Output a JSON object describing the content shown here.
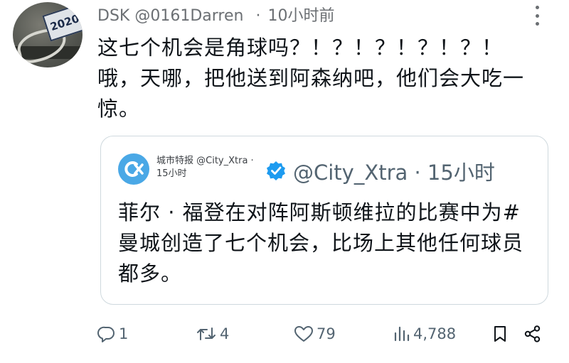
{
  "tweet": {
    "display_name": "DSK",
    "handle": "@0161Darren",
    "separator": "·",
    "time": "10小时前",
    "avatar_bib": "2020",
    "text": "这七个机会是角球吗？！？！？！？！？！ 哦，天哪，把他送到阿森纳吧，他们会大吃一惊。"
  },
  "quote": {
    "small_name": "城市特报 @City_Xtra ·",
    "small_time": "15小时",
    "handle_time": "@City_Xtra · 15小时",
    "text": "菲尔 · 福登在对阵阿斯顿维拉的比赛中为#曼城创造了七个机会，比场上其他任何球员都多。"
  },
  "actions": {
    "replies": "1",
    "retweets": "4",
    "likes": "79",
    "views": "4,788"
  },
  "icons": [
    "more-icon",
    "verified-icon",
    "reply-icon",
    "retweet-icon",
    "like-icon",
    "views-icon",
    "bookmark-icon",
    "share-icon"
  ],
  "colors": {
    "verified": "#1d9bf0",
    "logo": "#4aa8e6",
    "muted": "#536471"
  }
}
